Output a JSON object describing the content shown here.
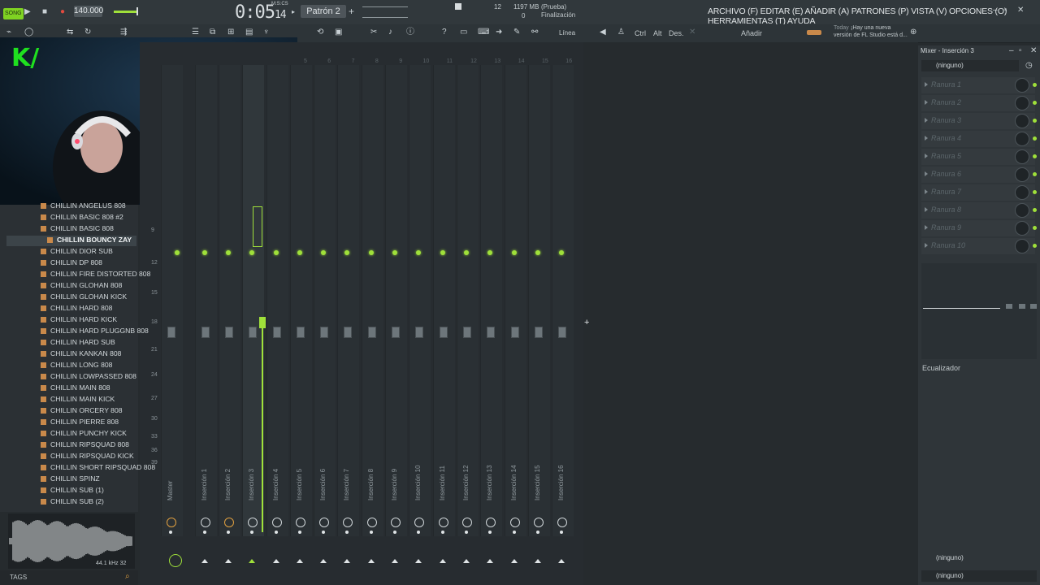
{
  "transport": {
    "mode": "SONG",
    "tempo": "140.000",
    "time": "0:05",
    "time_small": "14",
    "time_caption": "M:S:CS",
    "pattern": "Patrón 2",
    "cpu": "12",
    "memory": "1197 MB",
    "voices": "0",
    "hint_title": "(Prueba)",
    "hint_text": "Finalización"
  },
  "menu": {
    "items": "ARCHIVO (F) EDITAR (E) AÑADIR (A) PATRONES (P) VISTA (V) OPCIONES (O) HERRAMIENTAS (T) AYUDA"
  },
  "toolbar": {
    "line_label": "Línea",
    "ctrl": "Ctrl",
    "alt": "Alt",
    "des": "Des.",
    "add": "Añadir",
    "news_day": "Today",
    "news_line1": "¡Hay una nueva",
    "news_line2": "versión de FL Studio está d..."
  },
  "browser": {
    "items": [
      "CHILLIN ANGELUS 808",
      "CHILLIN BASIC 808 #2",
      "CHILLIN BASIC 808",
      "CHILLIN BOUNCY ZAY",
      "CHILLIN DIOR SUB",
      "CHILLIN DP 808",
      "CHILLIN FIRE DISTORTED 808",
      "CHILLIN GLOHAN 808",
      "CHILLIN GLOHAN KICK",
      "CHILLIN HARD 808",
      "CHILLIN HARD KICK",
      "CHILLIN HARD PLUGGNB 808",
      "CHILLIN HARD SUB",
      "CHILLIN KANKAN 808",
      "CHILLIN LONG 808",
      "CHILLIN LOWPASSED 808",
      "CHILLIN MAIN 808",
      "CHILLIN MAIN KICK",
      "CHILLIN ORCERY 808",
      "CHILLIN PIERRE 808",
      "CHILLIN PUNCHY KICK",
      "CHILLIN RIPSQUAD 808",
      "CHILLIN RIPSQUAD KICK",
      "CHILLIN SHORT RIPSQUAD 808",
      "CHILLIN SPINZ",
      "CHILLIN SUB (1)",
      "CHILLIN SUB (2)"
    ],
    "selected_index": 3,
    "wave_info": "44.1 kHz 32",
    "tags_label": "TAGS"
  },
  "mixer": {
    "db_scale": [
      "9",
      "12",
      "15",
      "18",
      "21",
      "24",
      "27",
      "30",
      "33",
      "36",
      "39"
    ],
    "top_numbers": [
      "5",
      "6",
      "7",
      "8",
      "9",
      "10",
      "11",
      "12",
      "13",
      "14",
      "15",
      "16"
    ],
    "channels": [
      "Master",
      "Inserción 1",
      "Inserción 2",
      "Inserción 3",
      "Inserción 4",
      "Inserción 5",
      "Inserción 6",
      "Inserción 7",
      "Inserción 8",
      "Inserción 9",
      "Inserción 10",
      "Inserción 11",
      "Inserción 12",
      "Inserción 13",
      "Inserción 14",
      "Inserción 15",
      "Inserción 16"
    ],
    "selected_channel": "Inserción 3"
  },
  "panel": {
    "title": "Mixer - Inserción 3",
    "input": "(ninguno)",
    "slots": [
      "Ranura 1",
      "Ranura 2",
      "Ranura 3",
      "Ranura 4",
      "Ranura 5",
      "Ranura 6",
      "Ranura 7",
      "Ranura 8",
      "Ranura 9",
      "Ranura 10"
    ],
    "eq_label": "Ecualizador",
    "output_in": "(ninguno)",
    "output_out": "(ninguno)"
  },
  "webcam": {
    "logo": "K/"
  },
  "colors": {
    "accent": "#9fe03a",
    "background": "#262b2e",
    "file_icon": "#c9894a"
  }
}
